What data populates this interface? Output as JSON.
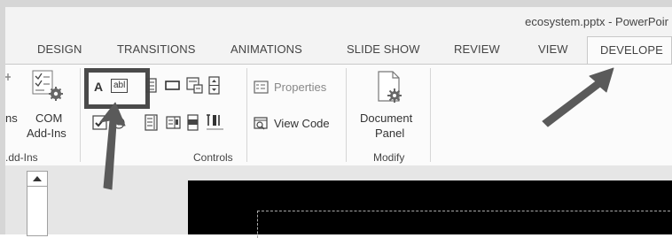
{
  "window": {
    "title": "ecosystem.pptx - PowerPoir"
  },
  "tabs": [
    {
      "label": "DESIGN"
    },
    {
      "label": "TRANSITIONS"
    },
    {
      "label": "ANIMATIONS"
    },
    {
      "label": "SLIDE SHOW"
    },
    {
      "label": "REVIEW"
    },
    {
      "label": "VIEW"
    },
    {
      "label": "DEVELOPE"
    }
  ],
  "ribbon": {
    "addins": {
      "partial_label": "ns",
      "com_line1": "COM",
      "com_line2": "Add-Ins",
      "group_label": ".dd-Ins"
    },
    "controls": {
      "properties_label": "Properties",
      "view_code_label": "View Code",
      "group_label": "Controls",
      "label_control_glyph": "A",
      "textbox_glyph": "abl"
    },
    "modify": {
      "doc_line1": "Document",
      "doc_line2": "Panel",
      "group_label": "Modify"
    }
  },
  "colors": {
    "highlight_box": "#4a4a4a",
    "arrow": "#5a5a5a",
    "slide_background": "#000000"
  }
}
